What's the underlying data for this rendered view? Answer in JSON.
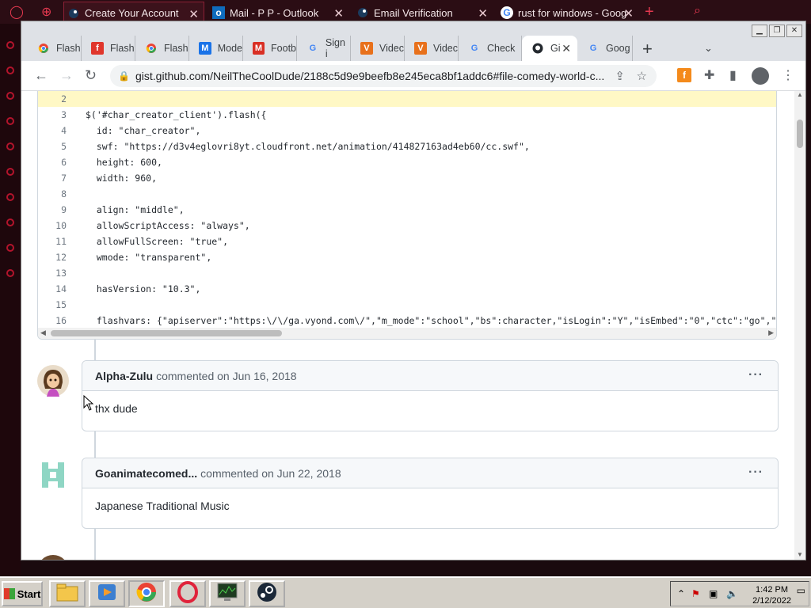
{
  "outer_browser": {
    "tabs": [
      {
        "label": "Create Your Account",
        "icon": "steam-icon",
        "active": true
      },
      {
        "label": "Mail - P P - Outlook",
        "icon": "outlook-icon",
        "active": false
      },
      {
        "label": "Email Verification",
        "icon": "steam-icon",
        "active": false
      },
      {
        "label": "rust for windows - Goog",
        "icon": "google-icon",
        "active": false
      }
    ],
    "close_glyph": "✕",
    "new_tab_glyph": "+",
    "search_glyph": "⌕"
  },
  "chrome": {
    "tabs": [
      {
        "label": "Flash",
        "icon": "chrome-icon"
      },
      {
        "label": "Flash",
        "icon": "flash-icon"
      },
      {
        "label": "Flash",
        "icon": "chrome-icon"
      },
      {
        "label": "Mode",
        "icon": "m-icon"
      },
      {
        "label": "Footb",
        "icon": "m-red-icon"
      },
      {
        "label": "Sign i",
        "icon": "google-icon"
      },
      {
        "label": "Videc",
        "icon": "v-icon"
      },
      {
        "label": "Videc",
        "icon": "v-icon"
      },
      {
        "label": "Check",
        "icon": "google-icon"
      },
      {
        "label": "Gi",
        "icon": "github-icon",
        "active": true
      },
      {
        "label": "Goog",
        "icon": "google-icon"
      }
    ],
    "new_tab_glyph": "+",
    "tab_search_glyph": "⌄",
    "tab_close_glyph": "✕",
    "url": "gist.github.com/NeilTheCoolDude/2188c5d9e9beefb8e245eca8bf1addc6#file-comedy-world-c...",
    "nav": {
      "back": "←",
      "forward": "→",
      "reload": "↻"
    }
  },
  "code": {
    "lines": [
      {
        "n": "2",
        "text": "",
        "highlight": true
      },
      {
        "n": "3",
        "text": "$('#char_creator_client').flash({"
      },
      {
        "n": "4",
        "text": "  id: \"char_creator\","
      },
      {
        "n": "5",
        "text": "  swf: \"https://d3v4eglovri8yt.cloudfront.net/animation/414827163ad4eb60/cc.swf\","
      },
      {
        "n": "6",
        "text": "  height: 600,"
      },
      {
        "n": "7",
        "text": "  width: 960,"
      },
      {
        "n": "8",
        "text": ""
      },
      {
        "n": "9",
        "text": "  align: \"middle\","
      },
      {
        "n": "10",
        "text": "  allowScriptAccess: \"always\","
      },
      {
        "n": "11",
        "text": "  allowFullScreen: \"true\","
      },
      {
        "n": "12",
        "text": "  wmode: \"transparent\","
      },
      {
        "n": "13",
        "text": ""
      },
      {
        "n": "14",
        "text": "  hasVersion: \"10.3\","
      },
      {
        "n": "15",
        "text": ""
      },
      {
        "n": "16",
        "text": "  flashvars: {\"apiserver\":\"https:\\/\\/ga.vyond.com\\/\",\"m_mode\":\"school\",\"bs\":character,\"isLogin\":\"Y\",\"isEmbed\":\"0\",\"ctc\":\"go\",\"tlang\""
      }
    ]
  },
  "comments": [
    {
      "author": "Alpha-Zulu",
      "meta": "commented on Jun 16, 2018",
      "body": "thx dude",
      "menu": "···"
    },
    {
      "author": "Goanimatecomed...",
      "meta": "commented on Jun 22, 2018",
      "body": "Japanese Traditional Music",
      "menu": "···"
    }
  ],
  "taskbar": {
    "start_label": "Start",
    "time": "1:42 PM",
    "date": "2/12/2022"
  }
}
